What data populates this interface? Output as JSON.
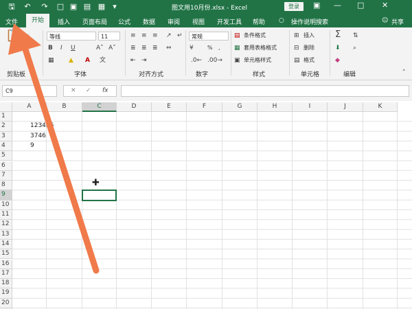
{
  "title_bar": {
    "doc_title": "图文用10月份.xlsx - Excel",
    "login": "登录",
    "icons": [
      "save-icon",
      "undo-icon",
      "redo-icon",
      "new-doc-icon",
      "open-icon",
      "print-preview-icon",
      "quick-print-icon"
    ]
  },
  "tabs": [
    "文件",
    "开始",
    "插入",
    "页面布局",
    "公式",
    "数据",
    "审阅",
    "视图",
    "开发工具",
    "帮助"
  ],
  "tell_me": "操作说明搜索",
  "share": "共享",
  "ribbon": {
    "font_name": "等线",
    "font_size": "11",
    "number_format": "常规",
    "percent": "%",
    "comma": ",",
    "conditional_format": "条件格式",
    "table_format": "套用表格格式",
    "cell_style": "单元格样式",
    "insert": "插入",
    "delete": "删除",
    "format": "格式",
    "group_clipboard": "剪贴板",
    "group_font": "字体",
    "group_alignment": "对齐方式",
    "group_number": "数字",
    "group_styles": "样式",
    "group_cells": "单元格",
    "group_editing": "编辑"
  },
  "formula_bar": {
    "name_box": "C9",
    "fx": "fx",
    "formula": ""
  },
  "grid": {
    "columns": [
      "A",
      "B",
      "C",
      "D",
      "E",
      "F",
      "G",
      "H",
      "I",
      "J",
      "K"
    ],
    "rows": [
      "1",
      "2",
      "3",
      "4",
      "5",
      "6",
      "7",
      "8",
      "9",
      "10",
      "11",
      "12",
      "13",
      "14",
      "15",
      "16",
      "17",
      "18",
      "19",
      "20",
      "21"
    ],
    "cells": {
      "B2": "123456",
      "B3": "3746",
      "B4": "9"
    },
    "selected_cell": "C9"
  },
  "colors": {
    "excel_green": "#217346",
    "arrow": "#f07a4a"
  }
}
